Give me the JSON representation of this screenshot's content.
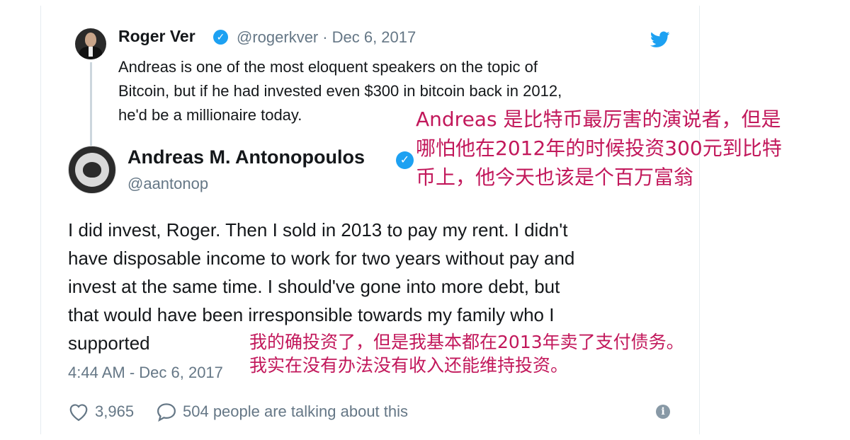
{
  "parent_tweet": {
    "author_name": "Roger Ver",
    "handle": "@rogerkver",
    "separator": "·",
    "date": "Dec 6, 2017",
    "text_lines": [
      "Andreas is one of the most eloquent speakers on the topic of",
      "Bitcoin, but if he had invested even $300 in bitcoin back in 2012,",
      "he'd be a millionaire today."
    ]
  },
  "reply_tweet": {
    "author_name": "Andreas M. Antonopoulos",
    "handle": "@aantonop",
    "text_lines": [
      "I did invest, Roger. Then I sold in 2013 to pay my rent. I didn't",
      "have disposable income to work for two years without pay and",
      "invest at the same time. I should've gone into more debt, but",
      "that would have been irresponsible towards my family who I",
      "supported"
    ],
    "timestamp": "4:44 AM - Dec 6, 2017",
    "likes": "3,965",
    "talking": "504 people are talking about this"
  },
  "annotations": {
    "top_lines": [
      "Andreas 是比特币最厉害的演说者，但是",
      "哪怕他在2012年的时候投资300元到比特",
      "币上，他今天也该是个百万富翁"
    ],
    "bottom_lines": [
      "我的确投资了，但是我基本都在2013年卖了支付债务。",
      "我实在没有办法没有收入还能维持投资。"
    ]
  },
  "icons": {
    "verified": "verified-badge-icon",
    "platform": "twitter-bird-icon",
    "like": "heart-icon",
    "reply": "speech-bubble-icon",
    "info": "info-icon"
  },
  "colors": {
    "verified_blue": "#1da1f2",
    "secondary_text": "#657786",
    "annotation": "#c2185b"
  }
}
